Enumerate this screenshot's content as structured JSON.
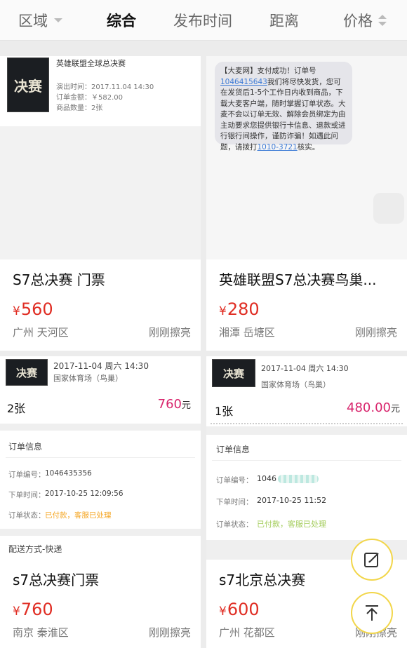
{
  "filters": {
    "region": "区域",
    "overall": "综合",
    "publish_time": "发布时间",
    "distance": "距离",
    "price": "价格"
  },
  "listings": [
    {
      "title": "S7总决赛 门票",
      "currency": "¥",
      "price": "560",
      "location": "广州 天河区",
      "time": "刚刚擦亮",
      "screenshot": {
        "event": "英雄联盟全球总决赛",
        "show_time": "演出时间：2017.11.04 14:30",
        "order_amount": "订单金额：￥582.00",
        "quantity": "商品数量：2张"
      }
    },
    {
      "title": "英雄联盟S7总决赛鸟巢...",
      "currency": "¥",
      "price": "280",
      "location": "湘潭 岳塘区",
      "time": "刚刚擦亮",
      "sms": {
        "line1": "【大麦网】支付成功！订单号",
        "order_no": "1046415643",
        "rest1": "我们将尽快发货，您可在发货后1-5个工作日内收到商品，下载大麦客户端，随时掌握订单状态。大麦不会以订单无效、解除会员绑定为由主动要求您提供银行卡信息、退款或进行银行间操作，谨防诈骗！如遇此问题，请拨打",
        "hotline": "1010-3721",
        "rest2": "核实。"
      }
    },
    {
      "title": "s7总决赛门票",
      "currency": "¥",
      "price": "760",
      "location": "南京 秦淮区",
      "time": "刚刚擦亮",
      "screenshot": {
        "datetime": "2017-11-04 周六 14:30",
        "venue": "国家体育场（鸟巢）",
        "count": "2张",
        "amount": "760",
        "unit": "元",
        "order_info": "订单信息",
        "order_no_label": "订单编号：",
        "order_no": "1046435356",
        "order_time_label": "下单时间：",
        "order_time": "2017-10-25 12:09:56",
        "status_label": "订单状态：",
        "status": "已付款，客服已处理",
        "delivery": "配送方式-快递"
      }
    },
    {
      "title": "s7北京总决赛",
      "currency": "¥",
      "price": "600",
      "location": "广州 花都区",
      "time": "刚刚擦亮",
      "screenshot": {
        "datetime": "2017-11-04 周六 14:30",
        "venue": "国家体育场（鸟巢）",
        "count": "1张",
        "amount": "480.00",
        "unit": "元",
        "order_info": "订单信息",
        "order_no_label": "订单编号：",
        "order_no": "1046",
        "order_time_label": "下单时间：",
        "order_time": "2017-10-25 11:52",
        "status_label": "订单状态：",
        "status": "已付款，客服已处理"
      }
    }
  ],
  "poster_text": "决赛",
  "colors": {
    "price": "#e02e24",
    "fab_border": "#f2d64a",
    "amount_pink": "#d8246c",
    "status_orange": "#f5a623"
  },
  "icons": {
    "edit": "edit-icon",
    "back_to_top": "arrow-up-icon"
  }
}
